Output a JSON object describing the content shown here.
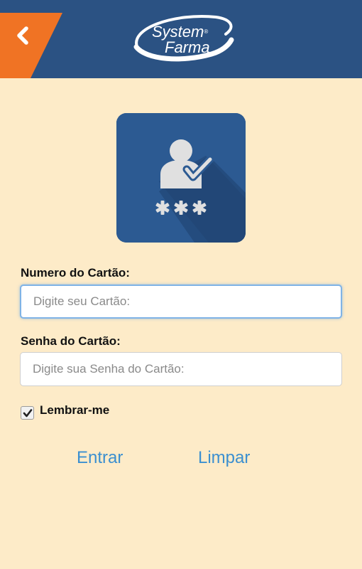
{
  "header": {
    "back_icon": "chevron-left-icon",
    "logo": {
      "line1": "System",
      "line2": "Farma",
      "reg_mark": "®"
    },
    "colors": {
      "bar": "#2b5283",
      "back_tab": "#f07324"
    }
  },
  "app_icon": {
    "icon": "user-check-password-icon",
    "color": "#2c5a92"
  },
  "form": {
    "card_label": "Numero do Cartão:",
    "card_placeholder": "Digite seu Cartão:",
    "card_value": "",
    "password_label": "Senha do Cartão:",
    "password_placeholder": "Digite sua Senha do Cartão:",
    "password_value": "",
    "remember_label": "Lembrar-me",
    "remember_checked": true
  },
  "actions": {
    "enter_label": "Entrar",
    "clear_label": "Limpar",
    "link_color": "#3b8fd0"
  },
  "page": {
    "background": "#fdebc8"
  }
}
